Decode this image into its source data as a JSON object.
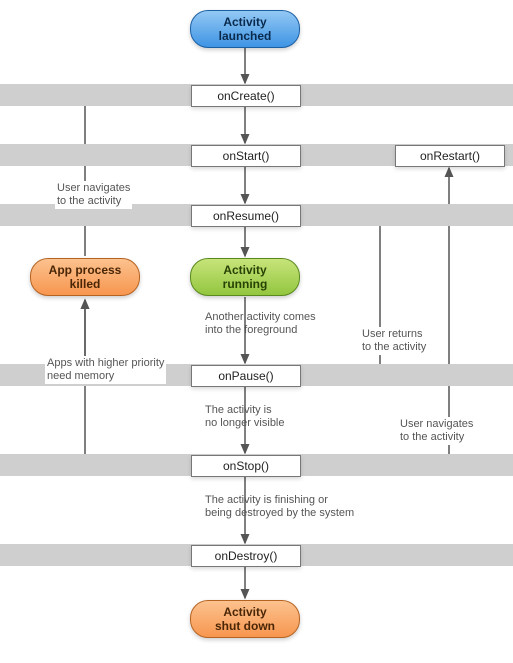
{
  "states": {
    "launched": [
      "Activity",
      "launched"
    ],
    "running": [
      "Activity",
      "running"
    ],
    "killed": [
      "App process",
      "killed"
    ],
    "shutdown": [
      "Activity",
      "shut down"
    ]
  },
  "methods": {
    "onCreate": "onCreate()",
    "onStart": "onStart()",
    "onRestart": "onRestart()",
    "onResume": "onResume()",
    "onPause": "onPause()",
    "onStop": "onStop()",
    "onDestroy": "onDestroy()"
  },
  "notes": {
    "navTo": [
      "User navigates",
      "to the activity"
    ],
    "foreground": [
      "Another activity comes",
      "into the foreground"
    ],
    "returns": [
      "User returns",
      "to the activity"
    ],
    "memory": [
      "Apps with higher priority",
      "need memory"
    ],
    "notVisible": [
      "The activity is",
      "no longer visible"
    ],
    "navBack": [
      "User navigates",
      "to the activity"
    ],
    "finishing": [
      "The activity is finishing or",
      "being destroyed by the system"
    ]
  },
  "edges": [
    {
      "from": "Activity launched",
      "to": "onCreate()"
    },
    {
      "from": "onCreate()",
      "to": "onStart()"
    },
    {
      "from": "onStart()",
      "to": "onResume()"
    },
    {
      "from": "onResume()",
      "to": "Activity running"
    },
    {
      "from": "Activity running",
      "to": "onPause()",
      "label": "Another activity comes into the foreground"
    },
    {
      "from": "onPause()",
      "to": "onResume()",
      "label": "User returns to the activity"
    },
    {
      "from": "onPause()",
      "to": "onStop()",
      "label": "The activity is no longer visible"
    },
    {
      "from": "onPause()",
      "to": "App process killed",
      "label": "Apps with higher priority need memory"
    },
    {
      "from": "onStop()",
      "to": "onRestart()",
      "label": "User navigates to the activity"
    },
    {
      "from": "onRestart()",
      "to": "onStart()"
    },
    {
      "from": "onStop()",
      "to": "onDestroy()",
      "label": "The activity is finishing or being destroyed by the system"
    },
    {
      "from": "onStop()",
      "to": "App process killed",
      "label": "Apps with higher priority need memory"
    },
    {
      "from": "App process killed",
      "to": "onCreate()",
      "label": "User navigates to the activity"
    },
    {
      "from": "onDestroy()",
      "to": "Activity shut down"
    }
  ]
}
